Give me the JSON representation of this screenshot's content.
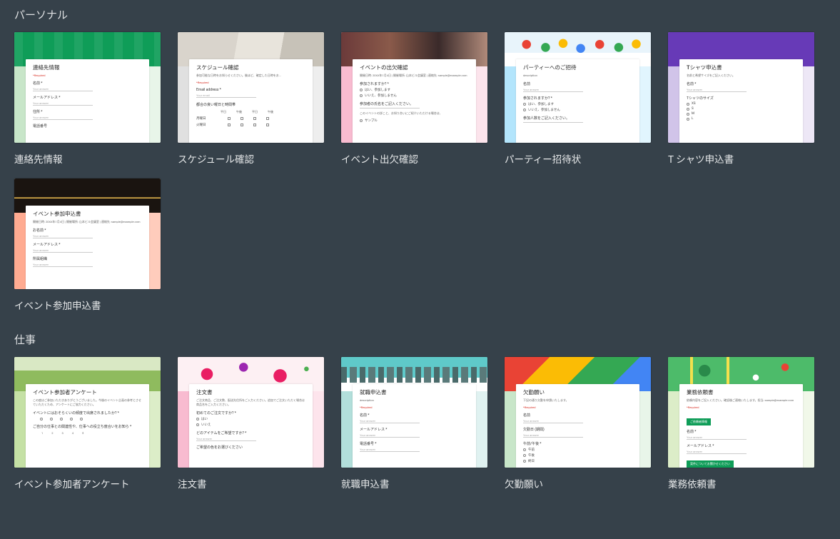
{
  "sections": {
    "personal": {
      "title": "パーソナル",
      "templates": [
        {
          "label": "連絡先情報",
          "form_title": "連絡先情報",
          "required": "*Required",
          "fields": [
            "名前 *",
            "メールアドレス *",
            "住所 *",
            "電話番号"
          ]
        },
        {
          "label": "スケジュール確認",
          "form_title": "スケジュール確認",
          "desc": "参加可能な日時をお知らせください。後ほど、確定した日時をお...",
          "required": "*Required",
          "email_label": "Email address *",
          "section_label": "都合の良い曜日と時間帯",
          "cols": [
            "平日",
            "午後",
            "平日",
            "午後"
          ],
          "rows": [
            "月曜日",
            "火曜日"
          ]
        },
        {
          "label": "イベント出欠確認",
          "form_title": "イベントの出欠確認",
          "desc": "開催日時: 20XX年1月4日 | 開催場所: 山本ビル会議室 | 連絡先: sample@example.com",
          "q1": "参加されますか? *",
          "opts1": [
            "はい、参加します",
            "いいえ、参加しません"
          ],
          "q2": "参加者の氏名をご記入ください。",
          "note": "このイベントの詳こと、お知り合いにご紹介いただける場合は、",
          "opt3": "サンプル"
        },
        {
          "label": "パーティー招待状",
          "form_title": "パーティーへのご招待",
          "desc": "description",
          "f_name": "名前",
          "q1": "参加されますか? *",
          "opts1": [
            "はい、参加します",
            "いいえ、参加しません"
          ],
          "q2": "参加人数をご記入ください。"
        },
        {
          "label": "T シャツ申込書",
          "form_title": "Tシャツ申込書",
          "desc": "名前と希望サイズをご記入ください。",
          "f_name": "名前 *",
          "q_size": "Tシャツのサイズ",
          "sizes": [
            "XS",
            "S",
            "M",
            "L"
          ]
        },
        {
          "label": "イベント参加申込書",
          "form_title": "イベント参加申込書",
          "desc": "開催日時: 20XX年1月4日 | 開催場所: 山本ビル会議室 | 連絡先: sample@example.com",
          "fields": [
            "お名前 *",
            "メールアドレス *",
            "所属組織"
          ]
        }
      ]
    },
    "work": {
      "title": "仕事",
      "templates": [
        {
          "label": "イベント参加者アンケート",
          "form_title": "イベント参加者アンケート",
          "desc": "この度はご参加いただきありがとうございました。今後のイベント企画の参考とさせていただくため、アンケートにご協力ください。",
          "q1": "イベントにはおそらくいの頻度で出席されましたか? *",
          "rating": [
            "1",
            "2",
            "3",
            "4",
            "5"
          ],
          "q2": "ご自分の仕事との関連性や、仕事への役立ち度合いをお知ら *"
        },
        {
          "label": "注文書",
          "form_title": "注文書",
          "desc": "ご注文商品、ご注文数、配送先住所をご入力ください。追加でご注文いただく場合は商品名をご入力ください。",
          "q1": "初めてのご注文ですか? *",
          "opts1": [
            "はい",
            "いいえ"
          ],
          "q2": "どのアイテムをご希望ですか? *",
          "q3": "ご希望の色をお選びください"
        },
        {
          "label": "就職申込書",
          "form_title": "就職申込書",
          "desc": "description",
          "required": "*Required",
          "fields": [
            "名前 *",
            "メールアドレス *",
            "電話番号 *"
          ]
        },
        {
          "label": "欠勤願い",
          "form_title": "欠勤願い",
          "desc": "下記の通り欠勤を申請いたします。",
          "required": "*Required",
          "fields": [
            "名前",
            "欠勤日 (期間)"
          ],
          "q_time": "午前/午後 *",
          "opts": [
            "午前",
            "午後",
            "終日"
          ]
        },
        {
          "label": "業務依頼書",
          "form_title": "業務依頼書",
          "desc": "依頼内容をご記入ください。確認後ご連絡いたします。担当: sample@example.com",
          "required": "*Required",
          "btn1": "ご依頼者情報",
          "fields": [
            "名前 *",
            "メールアドレス *"
          ],
          "btn2": "案件についてお聞かせください"
        }
      ]
    }
  }
}
